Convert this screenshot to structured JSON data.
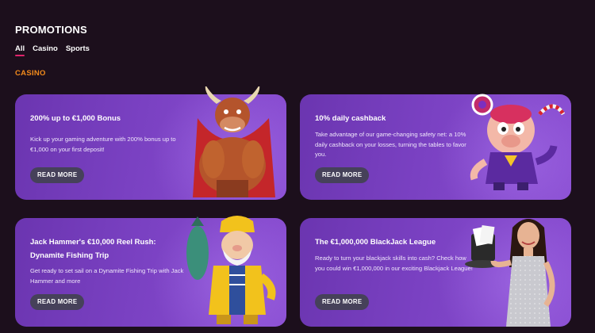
{
  "page": {
    "title": "PROMOTIONS",
    "section_label": "CASINO"
  },
  "tabs": [
    {
      "label": "All",
      "active": true
    },
    {
      "label": "Casino",
      "active": false
    },
    {
      "label": "Sports",
      "active": false
    }
  ],
  "cards": [
    {
      "title": "200% up to €1,000 Bonus",
      "description": "Kick up your gaming adventure with 200% bonus up to €1,000 on your first deposit!",
      "button": "READ MORE",
      "art_icon": "bull-mascot-icon"
    },
    {
      "title": "10% daily cashback",
      "description": "Take advantage of our game-changing safety net: a 10% daily cashback on your losses, turning the tables to favor you.",
      "button": "READ MORE",
      "art_icon": "pig-mascot-icon"
    },
    {
      "title": "Jack Hammer's €10,000 Reel Rush: Dynamite Fishing Trip",
      "description": "Get ready to set sail on a Dynamite Fishing Trip with Jack Hammer and more",
      "button": "READ MORE",
      "art_icon": "fisherman-mascot-icon"
    },
    {
      "title": "The €1,000,000 BlackJack League",
      "description": "Ready to turn your blackjack skills into cash? Check how you could win €1,000,000 in our exciting Blackjack League!",
      "button": "READ MORE",
      "art_icon": "dealer-woman-icon"
    }
  ],
  "colors": {
    "background": "#1c0f1c",
    "accent": "#e0236b",
    "section": "#f28a1b",
    "card": "#7a41c2",
    "button": "#46415a"
  }
}
